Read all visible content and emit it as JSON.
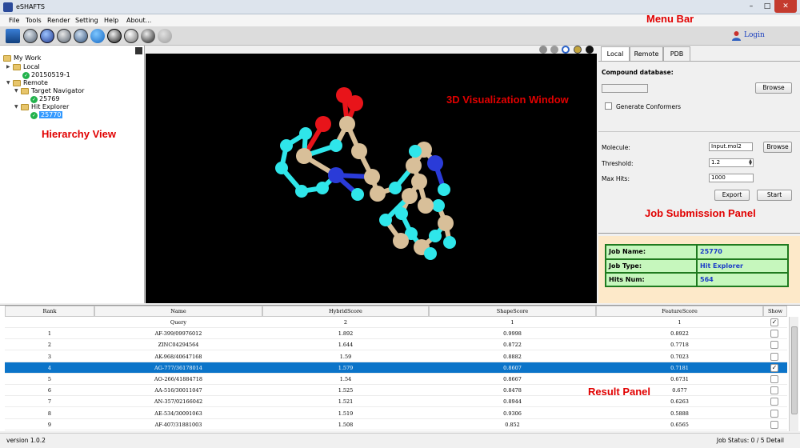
{
  "window": {
    "title": "eSHAFTS",
    "min": "–",
    "max": "□",
    "close": "✕"
  },
  "menu": [
    "File",
    "Tools",
    "Render",
    "Setting",
    "Help",
    "About..."
  ],
  "login": "Login",
  "annotations": {
    "menu_bar": "Menu Bar",
    "hierarchy_view": "Hierarchy View",
    "viz_window": "3D Visualization Window",
    "job_panel": "Job Submission Panel",
    "result_panel": "Result Panel"
  },
  "tree": {
    "root": "My Work",
    "local": "Local",
    "local_item": "20150519-1",
    "remote": "Remote",
    "target_nav": "Target Navigator",
    "target_item": "25769",
    "hit_explorer": "Hit Explorer",
    "hit_item": "25770"
  },
  "tabs": [
    "Local",
    "Remote",
    "PDB"
  ],
  "form": {
    "compound_db_label": "Compound database:",
    "compound_db_value": "",
    "browse1": "Browse",
    "generate_conformers": "Generate Conformers",
    "molecule_label": "Molecule:",
    "molecule_value": "Input.mol2",
    "browse2": "Browse",
    "threshold_label": "Threshold:",
    "threshold_value": "1.2",
    "maxhits_label": "Max Hits:",
    "maxhits_value": "1000",
    "export": "Export",
    "start": "Start"
  },
  "jobinfo": {
    "name_label": "Job Name:",
    "name_value": "25770",
    "type_label": "Job Type:",
    "type_value": "Hit Explorer",
    "hits_label": "Hits Num:",
    "hits_value": "564"
  },
  "results": {
    "columns": [
      "Rank",
      "Name",
      "HybridScore",
      "ShapeScore",
      "FeatureScore",
      "Show"
    ],
    "rows": [
      {
        "rank": "",
        "name": "Query",
        "hybrid": "2",
        "shape": "1",
        "feature": "1",
        "show": true
      },
      {
        "rank": "1",
        "name": "AF-399/09976012",
        "hybrid": "1.892",
        "shape": "0.9998",
        "feature": "0.8922",
        "show": false
      },
      {
        "rank": "2",
        "name": "ZINC04294564",
        "hybrid": "1.644",
        "shape": "0.8722",
        "feature": "0.7718",
        "show": false
      },
      {
        "rank": "3",
        "name": "AK-968/40647168",
        "hybrid": "1.59",
        "shape": "0.8882",
        "feature": "0.7023",
        "show": false
      },
      {
        "rank": "4",
        "name": "AG-777/36178014",
        "hybrid": "1.579",
        "shape": "0.8607",
        "feature": "0.7181",
        "show": true,
        "selected": true
      },
      {
        "rank": "5",
        "name": "AO-266/41884718",
        "hybrid": "1.54",
        "shape": "0.8667",
        "feature": "0.6731",
        "show": false
      },
      {
        "rank": "6",
        "name": "AA-516/30011047",
        "hybrid": "1.525",
        "shape": "0.8478",
        "feature": "0.677",
        "show": false
      },
      {
        "rank": "7",
        "name": "AN-357/02166042",
        "hybrid": "1.521",
        "shape": "0.8944",
        "feature": "0.6263",
        "show": false
      },
      {
        "rank": "8",
        "name": "AE-534/30091063",
        "hybrid": "1.519",
        "shape": "0.9306",
        "feature": "0.5888",
        "show": false
      },
      {
        "rank": "9",
        "name": "AF-407/31881003",
        "hybrid": "1.508",
        "shape": "0.852",
        "feature": "0.6565",
        "show": false
      }
    ]
  },
  "status": {
    "version": "version 1.0.2",
    "job_status": "Job Status: 0 / 5",
    "detail": "Detail"
  },
  "colors": {
    "carbon": "#d8bf99",
    "hydrogen": "#2fe6ea",
    "oxygen": "#e8141a",
    "nitrogen": "#2a3bd8",
    "selection": "#0b74c9"
  }
}
